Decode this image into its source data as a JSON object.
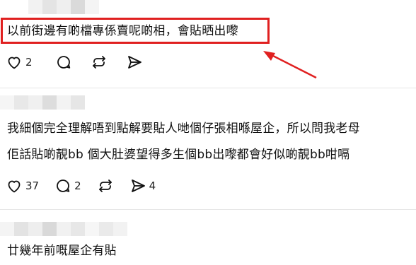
{
  "posts": [
    {
      "text_lines": [
        "以前街邊有啲檔專係賣呢啲相，會貼晒出嚟"
      ],
      "likes": "2",
      "replies": "",
      "reposts": "",
      "shares": ""
    },
    {
      "text_lines": [
        "我細個完全理解唔到點解要貼人哋個仔張相喺屋企，所以問我老母",
        "佢話貼啲靚bb 個大肚婆望得多生個bb出嚟都會好似啲靚bb咁嗝"
      ],
      "likes": "37",
      "replies": "2",
      "reposts": "",
      "shares": "4"
    },
    {
      "text_lines": [
        "廿幾年前嘅屋企有貼"
      ]
    }
  ],
  "icons": {
    "like": "heart-icon",
    "reply": "comment-icon",
    "repost": "repost-icon",
    "share": "send-icon"
  },
  "colors": {
    "highlight": "#e02020",
    "text": "#111111",
    "divider": "#e6e6e6"
  }
}
